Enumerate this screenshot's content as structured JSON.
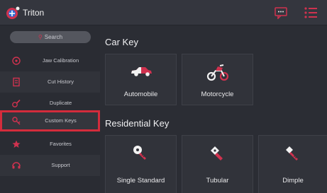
{
  "app": {
    "title": "Triton"
  },
  "colors": {
    "accent": "#d42c3c",
    "background": "#2b2d34",
    "sidebar": "#2a2c33",
    "card": "#31333a"
  },
  "topbar": {
    "icons": [
      "triton-logo-icon",
      "message-icon",
      "menu-list-icon"
    ]
  },
  "sidebar": {
    "search": {
      "label": "Search",
      "icon": "search-icon"
    },
    "items": [
      {
        "label": "Jaw Calibration",
        "icon": "target-icon"
      },
      {
        "label": "Cut History",
        "icon": "document-icon"
      },
      {
        "label": "Duplicate",
        "icon": "duplicate-icon"
      },
      {
        "label": "Custom Keys",
        "icon": "custom-keys-icon",
        "selected": true
      },
      {
        "label": "Favorites",
        "icon": "star-icon"
      },
      {
        "label": "Support",
        "icon": "support-icon"
      }
    ]
  },
  "sections": {
    "car": {
      "title": "Car Key",
      "cards": [
        {
          "label": "Automobile",
          "icon": "car-icon"
        },
        {
          "label": "Motorcycle",
          "icon": "motorcycle-icon"
        }
      ]
    },
    "residential": {
      "title": "Residential Key",
      "cards": [
        {
          "label": "Single Standard",
          "icon": "standard-key-icon"
        },
        {
          "label": "Tubular",
          "icon": "tubular-key-icon"
        },
        {
          "label": "Dimple",
          "icon": "dimple-key-icon"
        }
      ]
    }
  }
}
